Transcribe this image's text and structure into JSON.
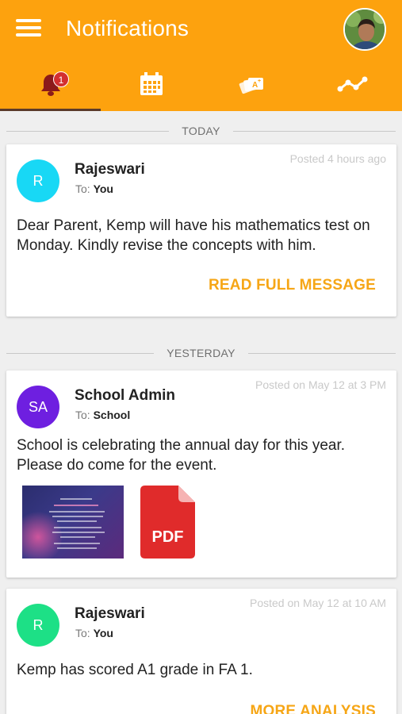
{
  "header": {
    "title": "Notifications",
    "color": "#fda20e"
  },
  "tabs": [
    {
      "name": "notifications",
      "icon": "bell-icon",
      "badge": "1",
      "active": true
    },
    {
      "name": "calendar",
      "icon": "calendar-icon",
      "active": false
    },
    {
      "name": "grades",
      "icon": "grade-cards-icon",
      "active": false
    },
    {
      "name": "analysis",
      "icon": "trend-line-icon",
      "active": false
    }
  ],
  "sections": {
    "today": "TODAY",
    "yesterday": "YESTERDAY"
  },
  "messages": [
    {
      "initials": "R",
      "avatar_color": "#18d8f5",
      "sender": "Rajeswari",
      "to_label": "To:",
      "to": "You",
      "posted": "Posted 4 hours ago",
      "body": "Dear Parent, Kemp will have his mathematics test on Monday. Kindly revise the concepts with him.",
      "action": "READ FULL MESSAGE"
    },
    {
      "initials": "SA",
      "avatar_color": "#6e1fe0",
      "sender": "School Admin",
      "to_label": "To:",
      "to": "School",
      "posted": "Posted on May 12 at 3 PM",
      "body": "School is celebrating the  annual day for this year. Please do come for the event.",
      "attachments": {
        "image_name": "annual-day-invitation",
        "pdf_label": "PDF"
      }
    },
    {
      "initials": "R",
      "avatar_color": "#1de086",
      "sender": "Rajeswari",
      "to_label": "To:",
      "to": "You",
      "posted": "Posted on May 12 at 10 AM",
      "body": "Kemp has scored A1 grade in FA 1.",
      "action": "MORE ANALYSIS"
    }
  ],
  "colors": {
    "accent": "#f6a616",
    "pdf_red": "#e02b2b"
  }
}
